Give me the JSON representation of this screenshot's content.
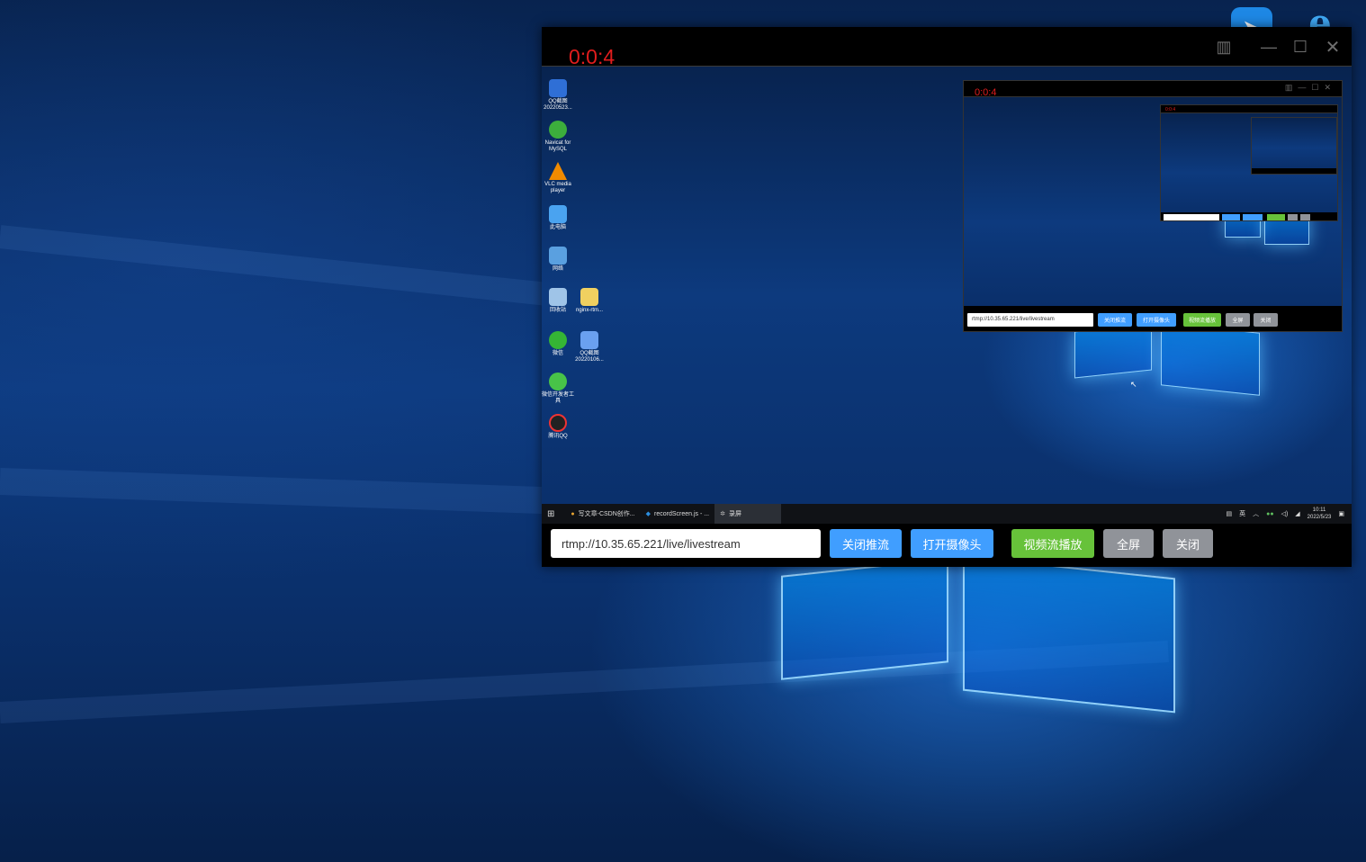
{
  "desktop": {
    "icons": [
      {
        "name": "send-icon",
        "glyph": "➤"
      },
      {
        "name": "internet-explorer-icon",
        "glyph": "e"
      }
    ]
  },
  "window": {
    "timer": "0:0:4",
    "controls": {
      "monitor": "▥",
      "minimize": "—",
      "maximize": "☐",
      "close": "✕"
    }
  },
  "preview": {
    "desktop_icons": [
      {
        "label": "QQ截图\n20220523...",
        "color": "#2f6fd6"
      },
      {
        "label": "Navicat for\nMySQL",
        "color": "#3cae3c"
      },
      {
        "label": "VLC media\nplayer",
        "color": "#f08a00"
      },
      {
        "label": "此电脑",
        "color": "#4aa3f0"
      },
      {
        "label": "网络",
        "color": "#5aa0e0"
      },
      {
        "label": "回收站",
        "color": "#9fc4e8"
      },
      {
        "label": "nginx-rtm...",
        "color": "#f0d060"
      },
      {
        "label": "微信",
        "color": "#35b535"
      },
      {
        "label": "QQ截图\n20220106...",
        "color": "#6aa0f0"
      },
      {
        "label": "微信开发者工\n具",
        "color": "#48c348"
      },
      {
        "label": "腾讯QQ",
        "color": "#222222"
      }
    ],
    "mini_timer": "0:0:4",
    "mini_url": "rtmp://10.35.65.221/live/livestream",
    "mini_buttons": [
      "关闭推流",
      "打开摄像头",
      "视频流播放",
      "全屏",
      "关闭"
    ],
    "taskbar": {
      "start": "⊞",
      "items": [
        {
          "label": "写文章-CSDN创作...",
          "icon": "●",
          "icon_color": "#e8a531"
        },
        {
          "label": "recordScreen.js - ...",
          "icon": "◆",
          "icon_color": "#2c8fe0"
        },
        {
          "label": "录屏",
          "icon": "✲",
          "icon_color": "#bbbbbb"
        }
      ],
      "ime": "英",
      "time": "10:11",
      "date": "2022/5/23"
    }
  },
  "controls": {
    "url_value": "rtmp://10.35.65.221/live/livestream",
    "stop_push": "关闭推流",
    "open_camera": "打开摄像头",
    "play_stream": "视频流播放",
    "fullscreen": "全屏",
    "close": "关闭"
  },
  "colors": {
    "blue_button": "#409eff",
    "green_button": "#67c23a",
    "gray_button": "#909399",
    "timer_red": "#e11d1d"
  }
}
